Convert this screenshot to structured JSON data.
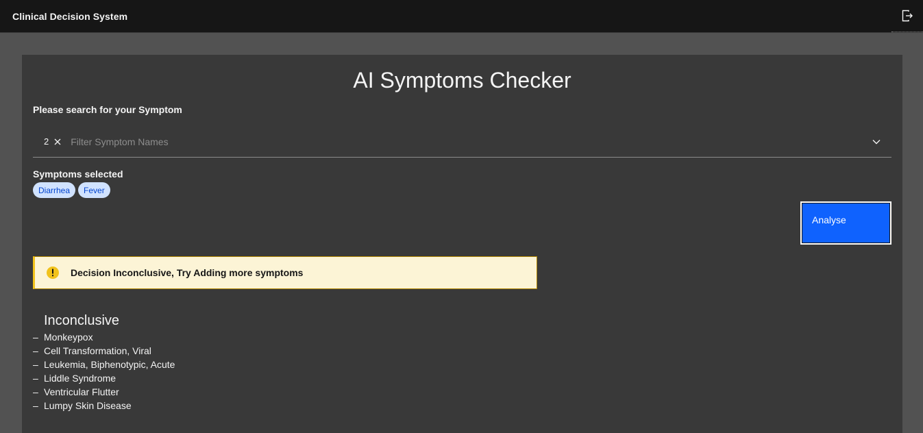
{
  "header": {
    "brand": "Clinical Decision System",
    "logout_icon": "logout-icon"
  },
  "main": {
    "title": "AI Symptoms Checker",
    "search_label": "Please search for your Symptom",
    "combo": {
      "selected_count": "2",
      "placeholder": "Filter Symptom Names"
    },
    "selected_label": "Symptoms selected",
    "selected_symptoms": [
      "Diarrhea",
      "Fever"
    ],
    "analyse_label": "Analyse",
    "notification": {
      "icon": "warning-icon",
      "message": "Decision Inconclusive, Try Adding more symptoms"
    },
    "result": {
      "title": "Inconclusive",
      "items": [
        "Monkeypox",
        "Cell Transformation, Viral",
        "Leukemia, Biphenotypic, Acute",
        "Liddle Syndrome",
        "Ventricular Flutter",
        "Lumpy Skin Disease"
      ]
    }
  },
  "colors": {
    "header_bg": "#161616",
    "page_bg": "#525252",
    "panel_bg": "#393939",
    "primary_button": "#0f62fe",
    "chip_bg": "#d0e2ff",
    "chip_text": "#0043ce",
    "warning_bg": "#fcf4d6",
    "warning_accent": "#f1c21b"
  }
}
